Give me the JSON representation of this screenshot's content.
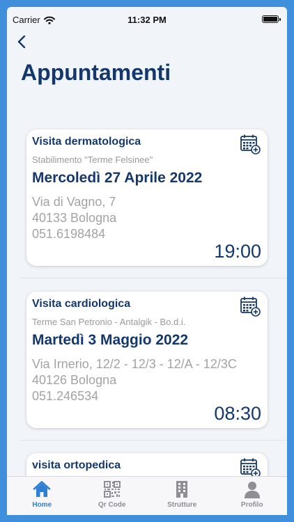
{
  "status_bar": {
    "carrier": "Carrier",
    "time": "11:32 PM"
  },
  "page": {
    "title": "Appuntamenti"
  },
  "appointments": [
    {
      "type": "Visita dermatologica",
      "facility": "Stabilimento \"Terme Felsinee\"",
      "date": "Mercoledì 27 Aprile 2022",
      "address_line1": "Via di Vagno, 7",
      "address_line2": "40133 Bologna",
      "phone": "051.6198484",
      "time": "19:00"
    },
    {
      "type": "Visita cardiologica",
      "facility": "Terme San Petronio - Antalgik - Bo.d.i.",
      "date": "Martedì 3 Maggio 2022",
      "address_line1": "Via Irnerio, 12/2 - 12/3 - 12/A - 12/3C",
      "address_line2": "40126 Bologna",
      "phone": "051.246534",
      "time": "08:30"
    },
    {
      "type": "visita ortopedica"
    }
  ],
  "tabbar": {
    "items": [
      {
        "label": "Home",
        "icon": "home-icon",
        "active": true
      },
      {
        "label": "Qr Code",
        "icon": "qr-code-icon"
      },
      {
        "label": "Strutture",
        "icon": "building-icon"
      },
      {
        "label": "Profilo",
        "icon": "person-icon"
      }
    ]
  },
  "colors": {
    "primary": "#14386b",
    "accent": "#2f7fd5",
    "background": "#f1f4f9",
    "frame": "#3f8fdc",
    "muted_text": "#a3a3a3"
  }
}
